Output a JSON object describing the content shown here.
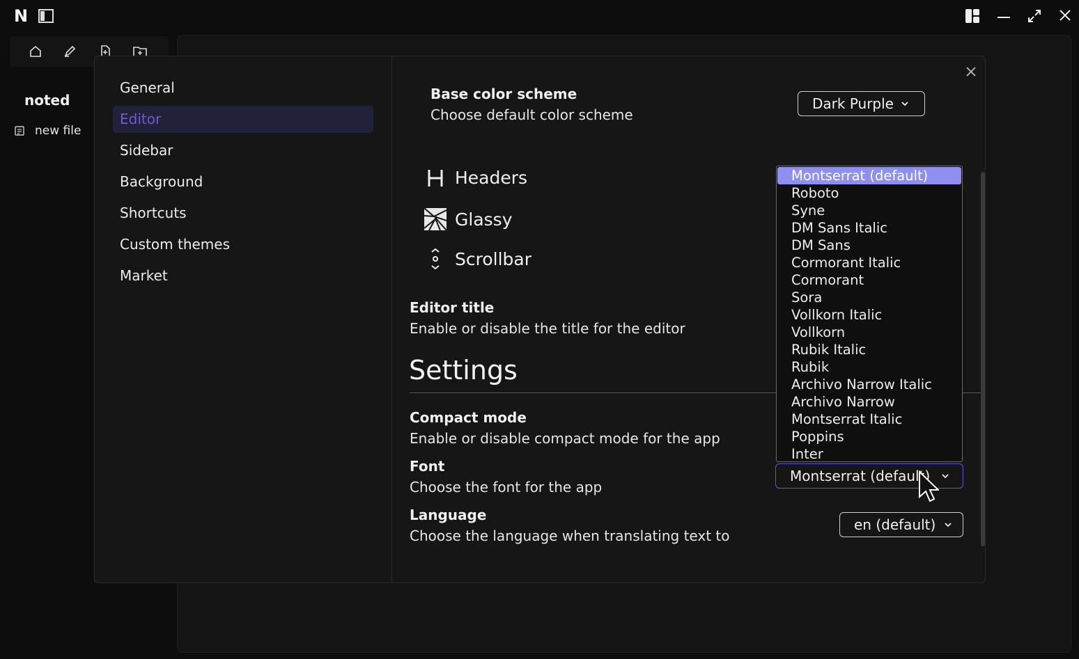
{
  "titlebar": {
    "logo_letter": "N",
    "icons": [
      "sidebar-toggle-icon",
      "layout-icon",
      "minimize-icon",
      "maximize-icon",
      "close-icon"
    ]
  },
  "left": {
    "app_name": "noted",
    "file_label": "new file",
    "toolbar_icons": [
      "home-icon",
      "edit-icon",
      "new-file-icon",
      "new-folder-icon"
    ]
  },
  "settings_nav": {
    "items": [
      "General",
      "Editor",
      "Sidebar",
      "Background",
      "Shortcuts",
      "Custom themes",
      "Market"
    ],
    "active": "Editor"
  },
  "content": {
    "base_color": {
      "title": "Base color scheme",
      "desc": "Choose default color scheme",
      "value": "Dark Purple"
    },
    "features": [
      {
        "label": "Headers",
        "icon": "header-icon"
      },
      {
        "label": "Glassy",
        "icon": "glassy-icon"
      },
      {
        "label": "Scrollbar",
        "icon": "scrollbar-icon"
      }
    ],
    "editor_title": {
      "title": "Editor title",
      "desc": "Enable or disable the title for the editor"
    },
    "section_heading": "Settings",
    "compact": {
      "title": "Compact mode",
      "desc": "Enable or disable compact mode for the app"
    },
    "font": {
      "title": "Font",
      "desc": "Choose the font for the app",
      "value": "Montserrat (default)"
    },
    "language": {
      "title": "Language",
      "desc": "Choose the language when translating text to",
      "value": "en (default)"
    }
  },
  "font_dropdown": {
    "options": [
      "Montserrat (default)",
      "Roboto",
      "Syne",
      "DM Sans Italic",
      "DM Sans",
      "Cormorant Italic",
      "Cormorant",
      "Sora",
      "Vollkorn Italic",
      "Vollkorn",
      "Rubik Italic",
      "Rubik",
      "Archivo Narrow Italic",
      "Archivo Narrow",
      "Montserrat Italic",
      "Poppins",
      "Inter"
    ],
    "selected": "Montserrat (default)"
  },
  "colors": {
    "accent": "#6b5bd8",
    "selected_option": "#8f8ff0",
    "background": "#0d0d0d",
    "panel": "#161616"
  }
}
